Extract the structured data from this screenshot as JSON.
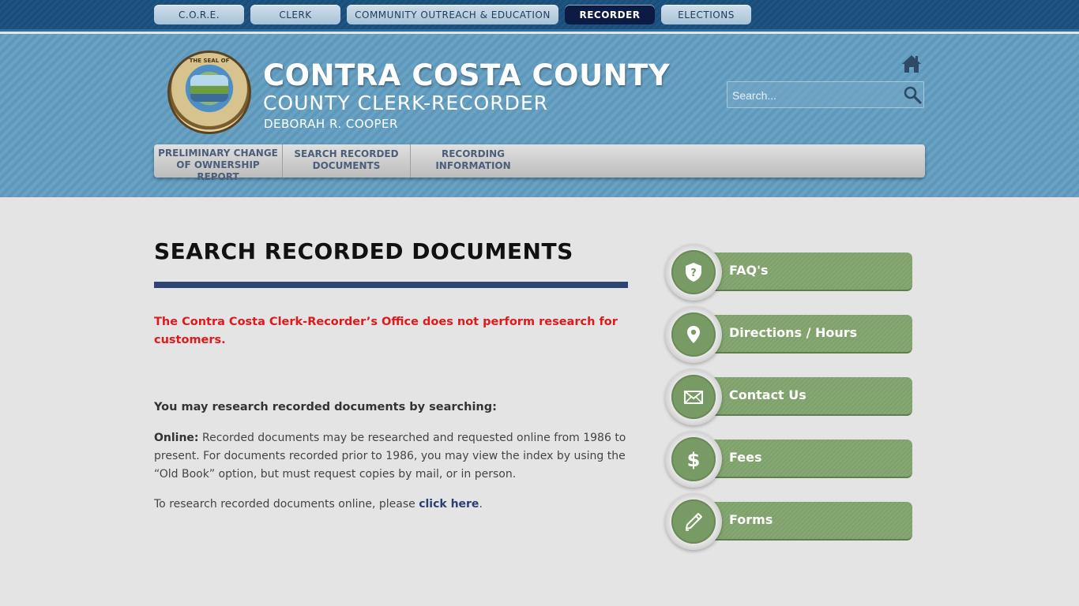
{
  "top_tabs": [
    {
      "label": "C.O.R.E."
    },
    {
      "label": "CLERK"
    },
    {
      "label": "COMMUNITY OUTREACH & EDUCATION"
    },
    {
      "label": "RECORDER"
    },
    {
      "label": "ELECTIONS"
    }
  ],
  "header": {
    "seal_text": "THE SEAL OF",
    "title": "CONTRA COSTA COUNTY",
    "subtitle": "COUNTY CLERK-RECORDER",
    "name": "DEBORAH R. COOPER",
    "search_placeholder": "Search..."
  },
  "subnav": [
    {
      "label": "PRELIMINARY CHANGE OF OWNERSHIP REPORT"
    },
    {
      "label": "SEARCH RECORDED DOCUMENTS"
    },
    {
      "label": "RECORDING INFORMATION"
    }
  ],
  "main": {
    "title": "SEARCH RECORDED DOCUMENTS",
    "notice": "The Contra Costa Clerk-Recorder’s Office does not perform research for customers.",
    "lead": "You may research recorded documents by searching:",
    "online_label": "Online:",
    "online_text": " Recorded documents may be researched and requested online from 1986 to present. For documents recorded prior to 1986, you may view the index by using the “Old Book” option, but must request copies by mail, or in person.",
    "research_prefix": "To research recorded documents online, please ",
    "research_link": "click here",
    "research_suffix": "."
  },
  "side_buttons": [
    {
      "label": "FAQ's",
      "icon": "shield-question-icon"
    },
    {
      "label": "Directions / Hours",
      "icon": "map-pin-icon"
    },
    {
      "label": "Contact Us",
      "icon": "envelope-icon"
    },
    {
      "label": "Fees",
      "icon": "dollar-icon"
    },
    {
      "label": "Forms",
      "icon": "pen-icon"
    }
  ],
  "colors": {
    "top_bar": "#1b4d78",
    "header_bg": "#6aa2c4",
    "active_tab": "#0b1b44",
    "title_rule": "#2e4574",
    "notice_red": "#e0191b",
    "link": "#2c3f73",
    "side_green": "#7ea06a"
  }
}
